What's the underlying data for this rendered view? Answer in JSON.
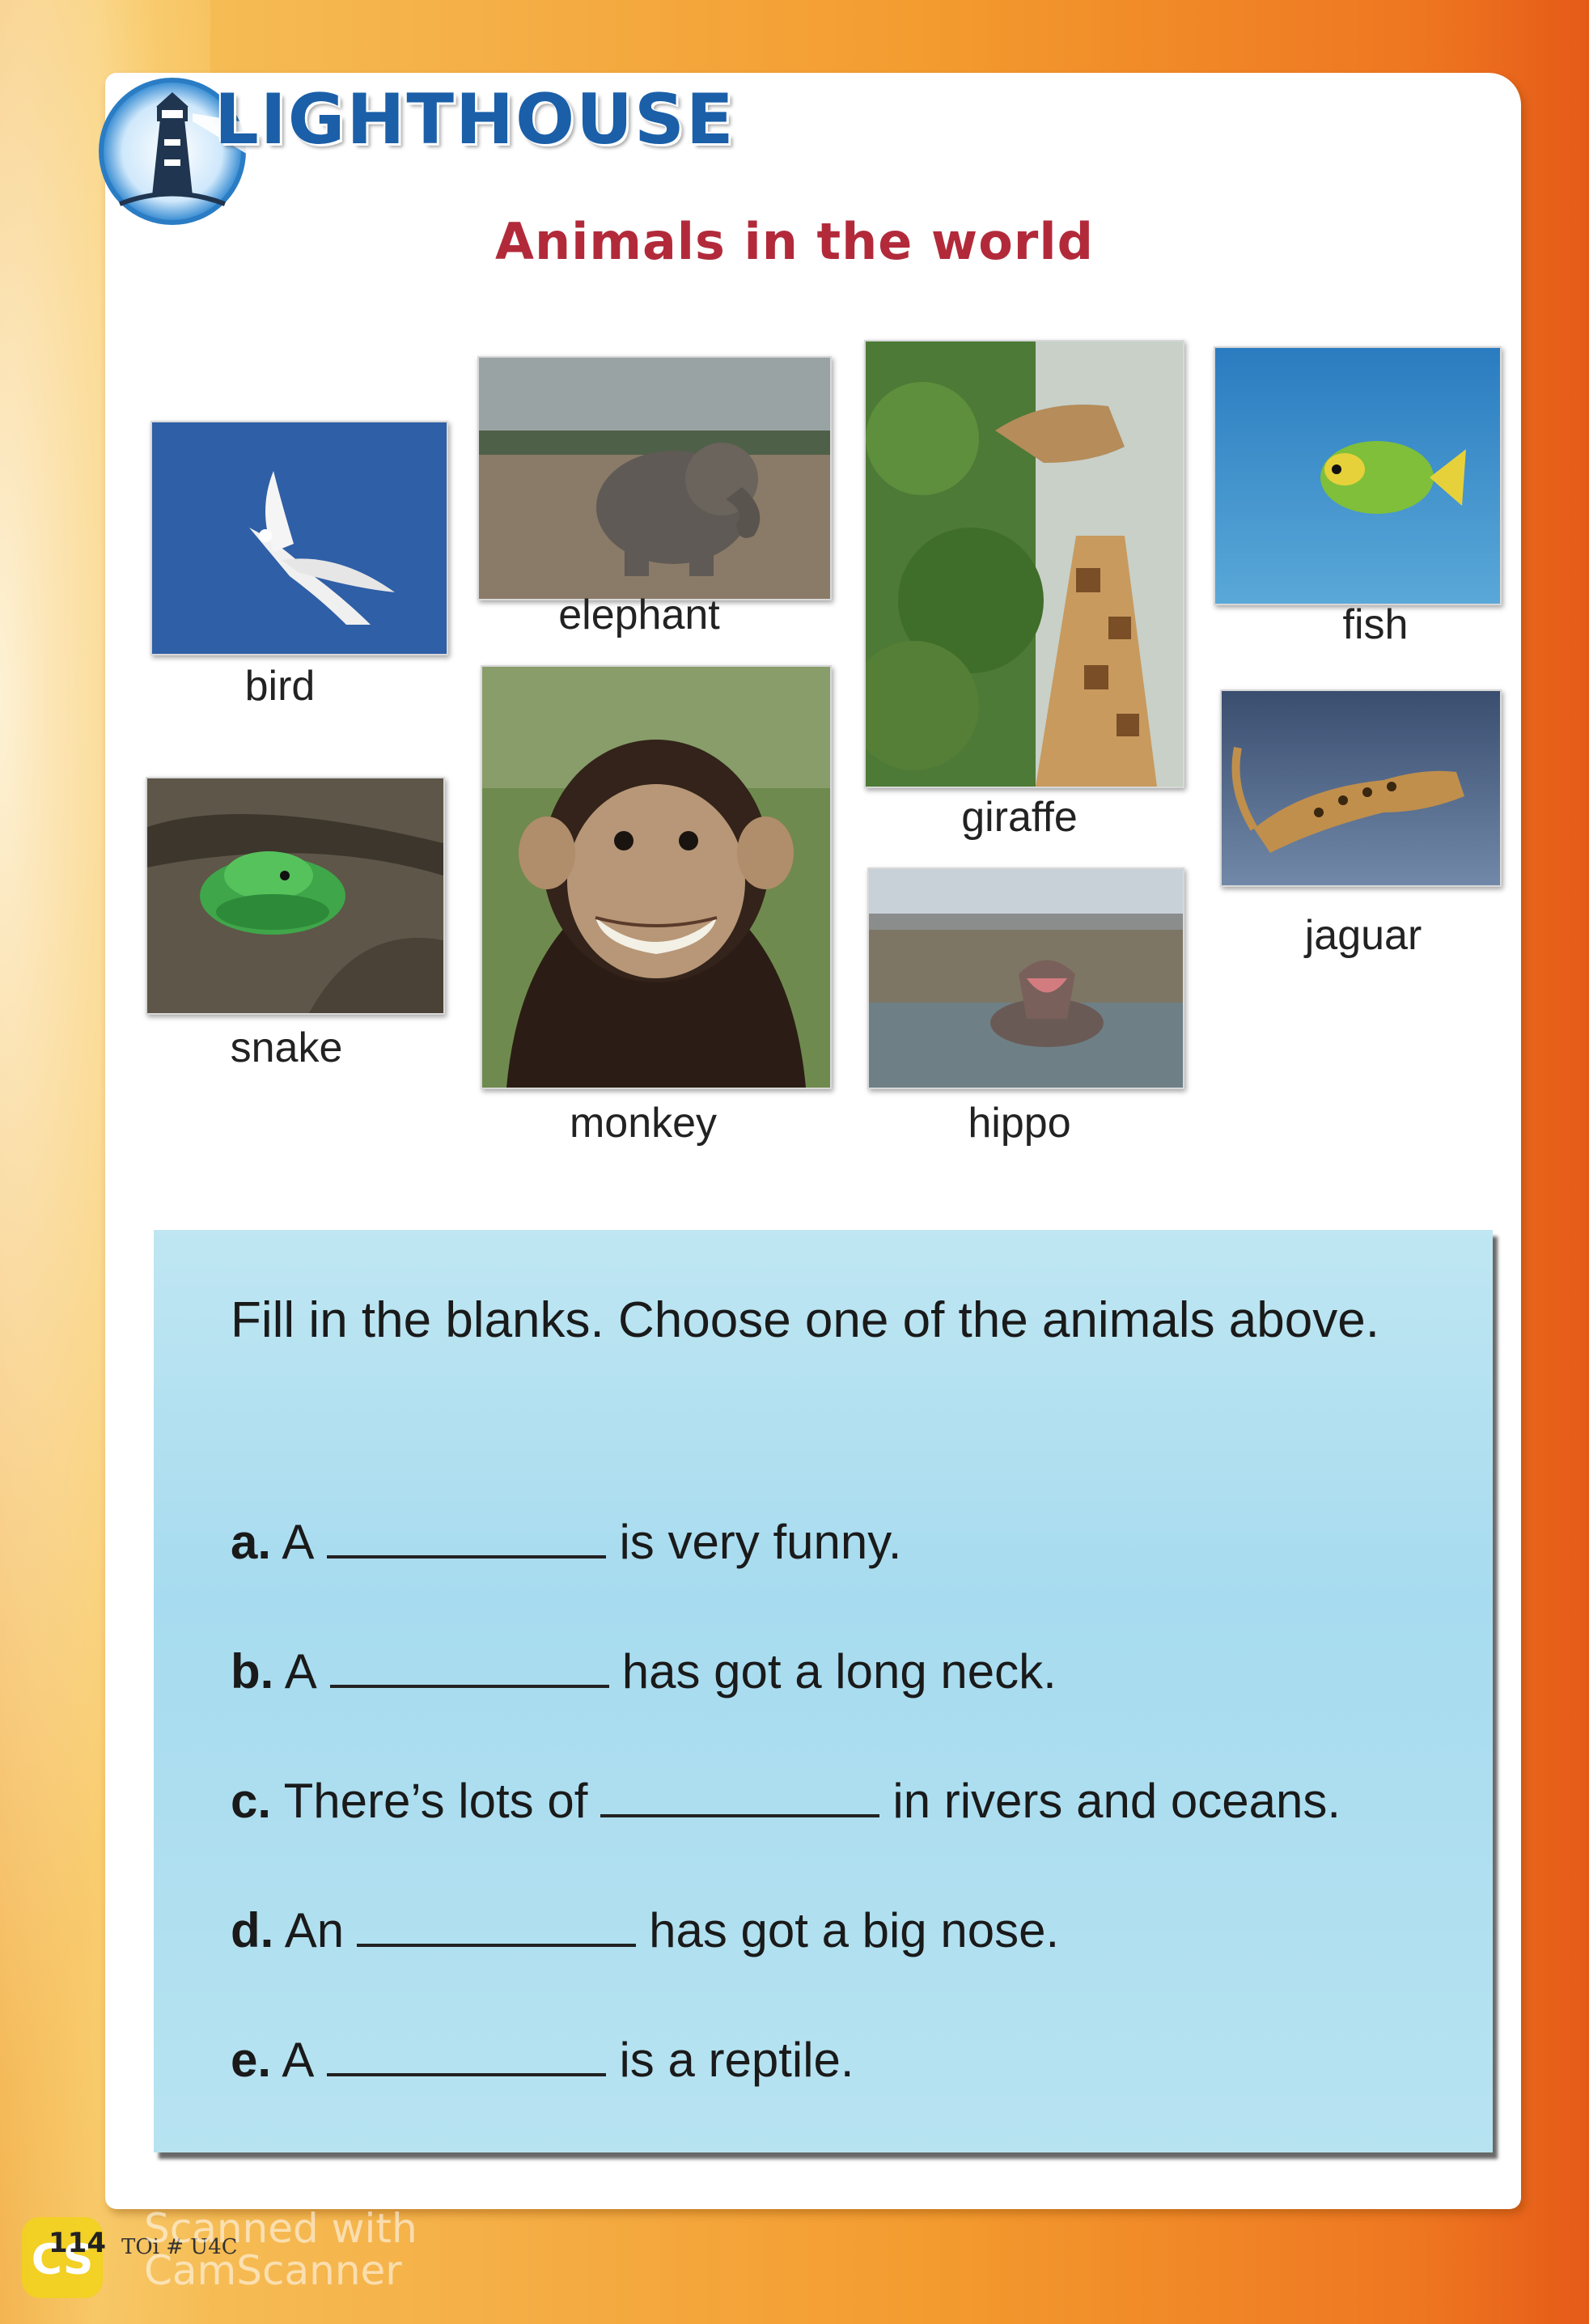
{
  "header": {
    "logo_text": "LIGHTHOUSE",
    "title": "Animals in the world"
  },
  "animals": {
    "bird": "bird",
    "elephant": "elephant",
    "giraffe": "giraffe",
    "fish": "fish",
    "snake": "snake",
    "monkey": "monkey",
    "hippo": "hippo",
    "jaguar": "jaguar"
  },
  "exercise": {
    "instruction": "Fill in the blanks. Choose one of the animals above.",
    "items": [
      {
        "letter": "a.",
        "before": "A",
        "after": "is very funny."
      },
      {
        "letter": "b.",
        "before": "A",
        "after": "has got a long neck."
      },
      {
        "letter": "c.",
        "before": "There’s lots of",
        "after": "in rivers and oceans."
      },
      {
        "letter": "d.",
        "before": "An",
        "after": "has got a big nose."
      },
      {
        "letter": "e.",
        "before": "A",
        "after": "is a reptile."
      }
    ]
  },
  "footer": {
    "page_number": "114",
    "code": "TOi # U4C",
    "watermark_line1": "Scanned with",
    "watermark_line2": "CamScanner"
  },
  "icons": [
    "lighthouse-icon",
    "camscanner-logo-icon"
  ]
}
